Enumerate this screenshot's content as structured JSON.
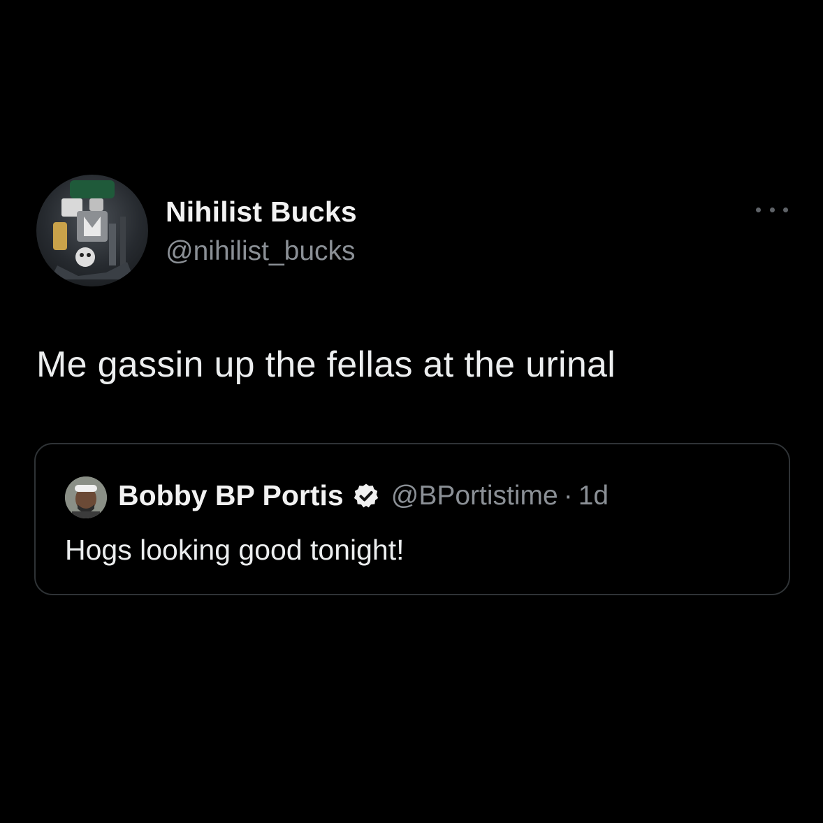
{
  "tweet": {
    "author_name": "Nihilist Bucks",
    "author_handle": "@nihilist_bucks",
    "text": "Me gassin up the fellas at the urinal",
    "more_icon": "more-horizontal-icon"
  },
  "quoted_tweet": {
    "author_name": "Bobby BP Portis",
    "verified_icon": "verified-badge-icon",
    "author_handle": "@BPortistime",
    "separator": "·",
    "time": "1d",
    "text": "Hogs looking good tonight!"
  },
  "colors": {
    "background": "#000000",
    "primary_text": "#e7e9ea",
    "secondary_text": "#8b9096",
    "card_border": "#2f3336"
  }
}
